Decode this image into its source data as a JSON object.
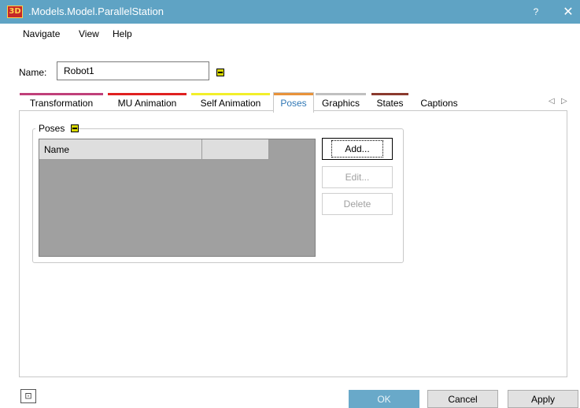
{
  "window": {
    "app_icon_label": "3D",
    "title": ".Models.Model.ParallelStation",
    "help_label": "?",
    "close_label": "✕"
  },
  "menu": [
    "Navigate",
    "View",
    "Help"
  ],
  "name_field": {
    "label": "Name:",
    "value": "Robot1"
  },
  "tabs": [
    {
      "label": "Transformation",
      "color": "#c0407a"
    },
    {
      "label": "MU Animation",
      "color": "#e02020"
    },
    {
      "label": "Self Animation",
      "color": "#f2ef2a"
    },
    {
      "label": "Poses",
      "color": "#e8923a",
      "active": true
    },
    {
      "label": "Graphics",
      "color": "#c0c0c0"
    },
    {
      "label": "States",
      "color": "#8b3a2e"
    },
    {
      "label": "Captions",
      "color": ""
    }
  ],
  "tab_scroll": {
    "left": "◁",
    "right": "▷"
  },
  "poses_group": {
    "title": "Poses",
    "columns": [
      "Name",
      ""
    ],
    "rows": [],
    "buttons": {
      "add": "Add...",
      "edit": "Edit...",
      "delete": "Delete"
    }
  },
  "footer": {
    "status_icon": "⊡",
    "ok": "OK",
    "cancel": "Cancel",
    "apply": "Apply"
  }
}
